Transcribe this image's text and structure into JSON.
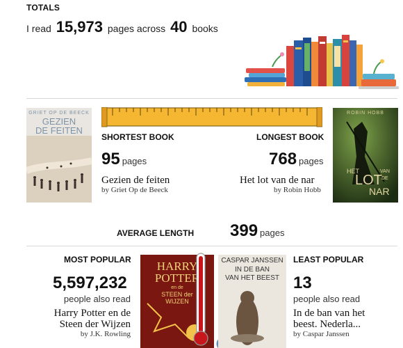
{
  "totals": {
    "heading": "TOTALS",
    "prefix": "I read",
    "pages": "15,973",
    "middle": "pages across",
    "books": "40",
    "suffix": "books"
  },
  "shortest": {
    "heading": "SHORTEST BOOK",
    "pages": "95",
    "unit": "pages",
    "title": "Gezien de feiten",
    "author": "by Griet Op de Beeck",
    "cover_lines": [
      "GRIET OP DE BEECK",
      "GEZIEN",
      "DE FEITEN"
    ]
  },
  "longest": {
    "heading": "LONGEST BOOK",
    "pages": "768",
    "unit": "pages",
    "title": "Het lot van de nar",
    "author": "by Robin Hobb",
    "cover_lines": [
      "ROBIN HOBB",
      "HET",
      "LOT",
      "VAN",
      "DE",
      "NAR"
    ]
  },
  "average": {
    "label": "AVERAGE LENGTH",
    "pages": "399",
    "unit": "pages"
  },
  "most_popular": {
    "heading": "MOST POPULAR",
    "count": "5,597,232",
    "unit": "people also read",
    "title_line1": "Harry Potter en de",
    "title_line2": "Steen der Wijzen",
    "author": "by J.K. Rowling",
    "cover_lines": [
      "HARRY",
      "POTTER",
      "en de",
      "STEEN der",
      "WIJZEN"
    ]
  },
  "least_popular": {
    "heading": "LEAST POPULAR",
    "count": "13",
    "unit": "people also read",
    "title_line1": "In de ban van het",
    "title_line2": "beest. Nederla...",
    "author": "by Caspar Janssen",
    "cover_lines": [
      "CASPAR JANSSEN",
      "IN DE BAN",
      "VAN HET BEEST"
    ]
  },
  "colors": {
    "ruler": "#f5b731",
    "thermo_red": "#c8161d",
    "thermo_blue": "#3a8fd8"
  }
}
